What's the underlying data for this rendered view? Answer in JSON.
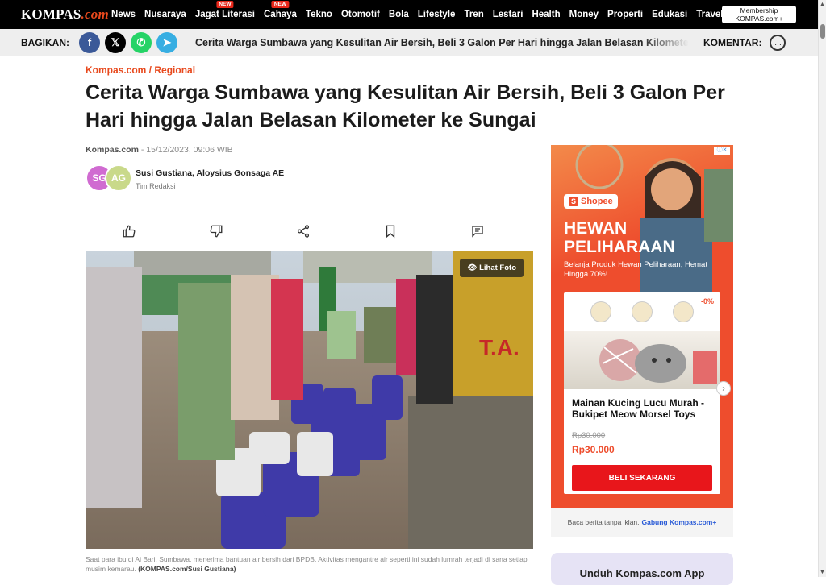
{
  "site": {
    "logo_text": "KOMPAS",
    "logo_suffix": ".com",
    "membership_line1": "Membership",
    "membership_line2": "KOMPAS.com+"
  },
  "nav": {
    "items": [
      {
        "label": "News",
        "new": ""
      },
      {
        "label": "Nusaraya",
        "new": ""
      },
      {
        "label": "Jagat Literasi",
        "new": "NEW"
      },
      {
        "label": "Cahaya",
        "new": "NEW"
      },
      {
        "label": "Tekno",
        "new": ""
      },
      {
        "label": "Otomotif",
        "new": ""
      },
      {
        "label": "Bola",
        "new": ""
      },
      {
        "label": "Lifestyle",
        "new": ""
      },
      {
        "label": "Tren",
        "new": ""
      },
      {
        "label": "Lestari",
        "new": ""
      },
      {
        "label": "Health",
        "new": ""
      },
      {
        "label": "Money",
        "new": ""
      },
      {
        "label": "Properti",
        "new": ""
      },
      {
        "label": "Edukasi",
        "new": ""
      },
      {
        "label": "Travel",
        "new": ""
      }
    ],
    "menu_icon": "hamburger-icon"
  },
  "sharebar": {
    "label": "BAGIKAN:",
    "icons": [
      "facebook-icon",
      "x-icon",
      "whatsapp-icon",
      "telegram-icon"
    ],
    "ticker": "Cerita Warga Sumbawa yang Kesulitan Air Bersih, Beli 3 Galon Per Hari hingga Jalan Belasan Kilometer ke S",
    "komentar": "KOMENTAR:"
  },
  "article": {
    "breadcrumb": "Kompas.com / Regional",
    "title": "Cerita Warga Sumbawa yang Kesulitan Air Bersih, Beli 3 Galon Per Hari hingga Jalan Belasan Kilometer ke Sungai",
    "source": "Kompas.com",
    "date": " - 15/12/2023, 09:06 WIB",
    "avatar1": "SG",
    "avatar2": "AG",
    "authors": "Susi Gustiana,  Aloysius Gonsaga AE",
    "team": "Tim Redaksi",
    "lihat_foto": "Lihat Foto",
    "caption": "Saat para ibu di Ai Bari, Sumbawa, menerima bantuan air bersih dari BPDB. Aktivitas mengantre air seperti ini sudah lumrah terjadi di sana setiap musim kemarau.",
    "caption_credit": "(KOMPAS.com/Susi Gustiana)",
    "truck_text": "T.A."
  },
  "ad": {
    "brand": "Shopee",
    "title_line1": "HEWAN",
    "title_line2": "PELIHARAAN",
    "subtitle": "Belanja Produk Hewan Peliharaan, Hemat Hingga 70%!",
    "discount": "-0%",
    "product": "Mainan Kucing Lucu Murah - Bukipet Meow Morsel Toys",
    "old_price": "Rp30.000",
    "new_price": "Rp30.000",
    "cta": "BELI SEKARANG",
    "no_ads_text": "Baca berita tanpa iklan.",
    "no_ads_link": "Gabung Kompas.com+",
    "app_promo": "Unduh Kompas.com App"
  }
}
